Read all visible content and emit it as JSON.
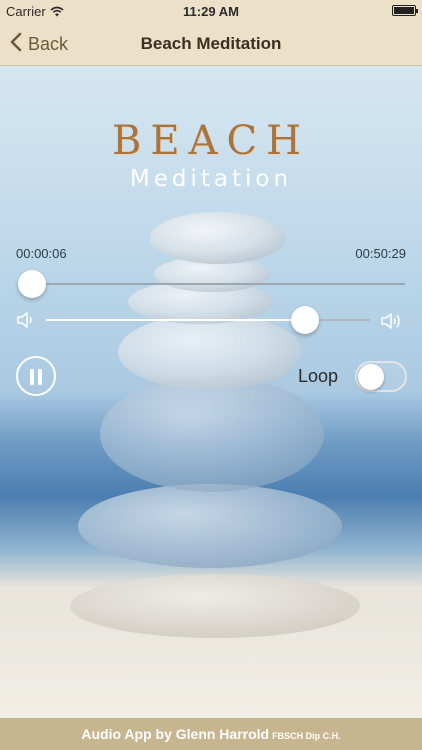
{
  "status_bar": {
    "carrier": "Carrier",
    "time": "11:29 AM",
    "wifi_icon": "wifi-icon",
    "battery_icon": "battery-icon"
  },
  "nav": {
    "back_label": "Back",
    "back_icon": "chevron-left-icon",
    "title": "Beach Meditation"
  },
  "artwork": {
    "title": "BEACH",
    "subtitle": "Meditation"
  },
  "player": {
    "elapsed": "00:00:06",
    "duration": "00:50:29",
    "progress": 0.002,
    "volume": 0.8,
    "state_icon": "pause-icon",
    "volume_low_icon": "volume-low-icon",
    "volume_high_icon": "volume-high-icon"
  },
  "loop": {
    "label": "Loop",
    "enabled": false
  },
  "footer": {
    "text": "Audio App by Glenn Harrold",
    "credentials": "FBSCH Dip C.H."
  },
  "colors": {
    "bar": "#ece1c8",
    "title_accent": "#a9753f",
    "footer": "#c7b58f"
  }
}
